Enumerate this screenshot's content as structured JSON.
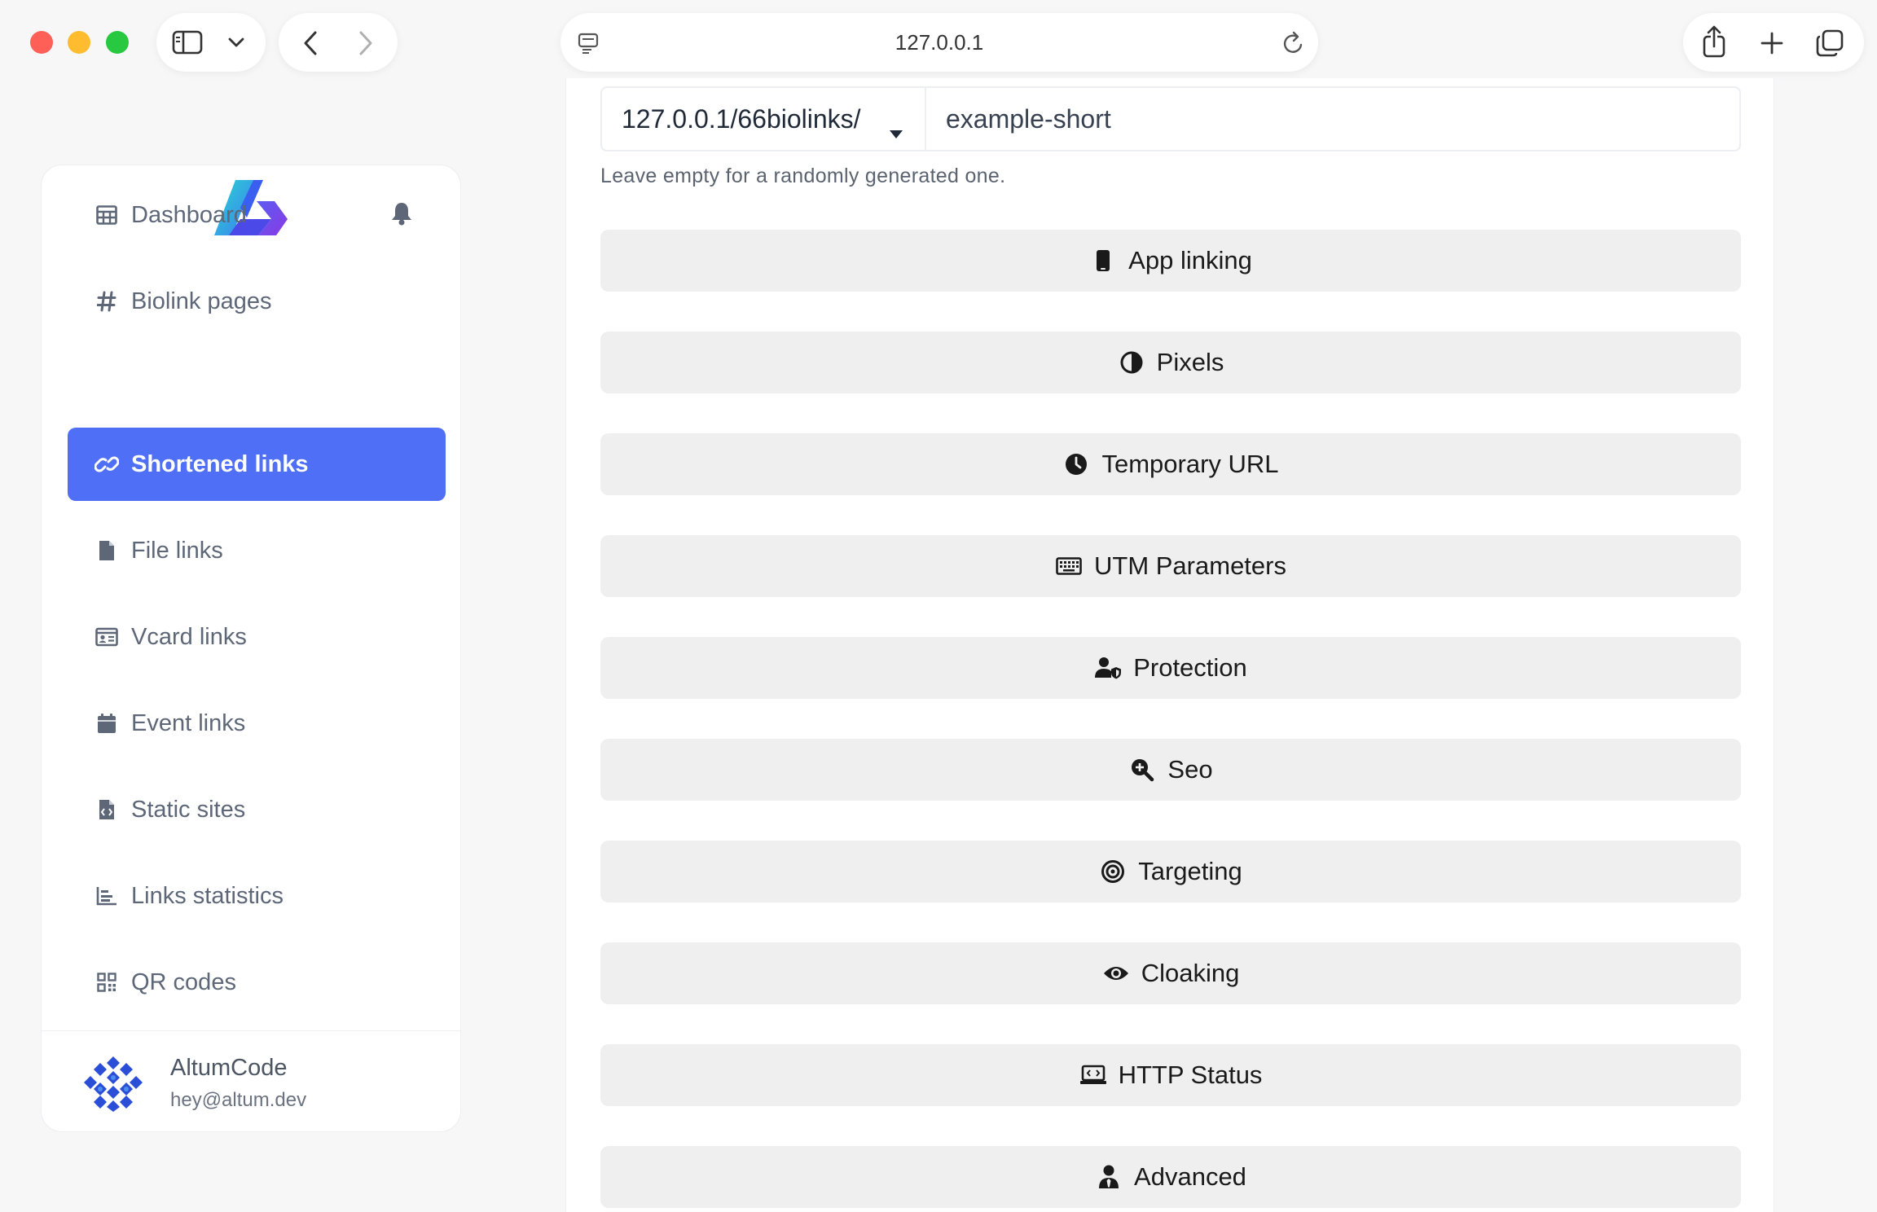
{
  "browser": {
    "url": "127.0.0.1"
  },
  "sidebar": {
    "items": [
      {
        "label": "Dashboard",
        "icon": "table-icon"
      },
      {
        "label": "Biolink pages",
        "icon": "hash-icon"
      },
      {
        "label": "Shortened links",
        "icon": "link-icon",
        "active": true
      },
      {
        "label": "File links",
        "icon": "file-icon"
      },
      {
        "label": "Vcard links",
        "icon": "id-card-icon"
      },
      {
        "label": "Event links",
        "icon": "calendar-icon"
      },
      {
        "label": "Static sites",
        "icon": "file-code-icon"
      },
      {
        "label": "Links statistics",
        "icon": "chart-bar-icon"
      },
      {
        "label": "QR codes",
        "icon": "qrcode-icon"
      }
    ],
    "user": {
      "name": "AltumCode",
      "email": "hey@altum.dev"
    }
  },
  "form": {
    "domain_value": "127.0.0.1/66biolinks/",
    "alias_value": "example-short",
    "helper_text": "Leave empty for a randomly generated one."
  },
  "sections": [
    {
      "label": "App linking",
      "icon": "mobile-icon"
    },
    {
      "label": "Pixels",
      "icon": "adjust-icon"
    },
    {
      "label": "Temporary URL",
      "icon": "clock-icon"
    },
    {
      "label": "UTM Parameters",
      "icon": "keyboard-icon"
    },
    {
      "label": "Protection",
      "icon": "user-shield-icon"
    },
    {
      "label": "Seo",
      "icon": "search-plus-icon"
    },
    {
      "label": "Targeting",
      "icon": "bullseye-icon"
    },
    {
      "label": "Cloaking",
      "icon": "eye-icon"
    },
    {
      "label": "HTTP Status",
      "icon": "laptop-code-icon"
    },
    {
      "label": "Advanced",
      "icon": "user-tie-icon"
    }
  ],
  "colors": {
    "accent": "#4f6ff7",
    "section_bg": "#efefef",
    "sidebar_text": "#5d6778"
  }
}
